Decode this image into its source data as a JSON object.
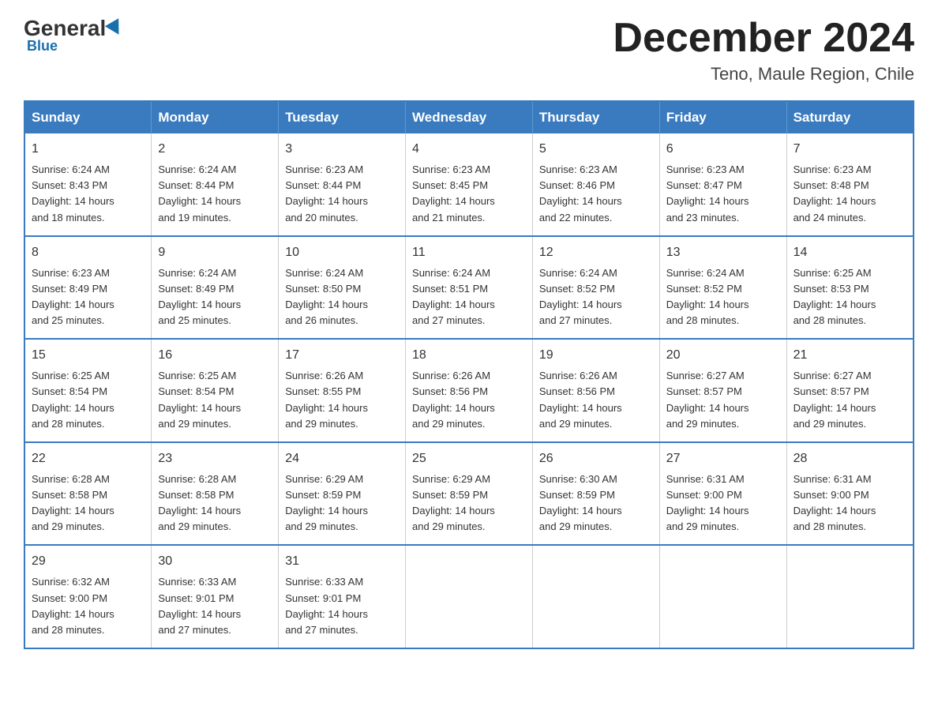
{
  "header": {
    "logo_general": "General",
    "logo_blue": "Blue",
    "month_title": "December 2024",
    "location": "Teno, Maule Region, Chile"
  },
  "days_of_week": [
    "Sunday",
    "Monday",
    "Tuesday",
    "Wednesday",
    "Thursday",
    "Friday",
    "Saturday"
  ],
  "weeks": [
    [
      {
        "day": "1",
        "sunrise": "6:24 AM",
        "sunset": "8:43 PM",
        "daylight": "14 hours and 18 minutes."
      },
      {
        "day": "2",
        "sunrise": "6:24 AM",
        "sunset": "8:44 PM",
        "daylight": "14 hours and 19 minutes."
      },
      {
        "day": "3",
        "sunrise": "6:23 AM",
        "sunset": "8:44 PM",
        "daylight": "14 hours and 20 minutes."
      },
      {
        "day": "4",
        "sunrise": "6:23 AM",
        "sunset": "8:45 PM",
        "daylight": "14 hours and 21 minutes."
      },
      {
        "day": "5",
        "sunrise": "6:23 AM",
        "sunset": "8:46 PM",
        "daylight": "14 hours and 22 minutes."
      },
      {
        "day": "6",
        "sunrise": "6:23 AM",
        "sunset": "8:47 PM",
        "daylight": "14 hours and 23 minutes."
      },
      {
        "day": "7",
        "sunrise": "6:23 AM",
        "sunset": "8:48 PM",
        "daylight": "14 hours and 24 minutes."
      }
    ],
    [
      {
        "day": "8",
        "sunrise": "6:23 AM",
        "sunset": "8:49 PM",
        "daylight": "14 hours and 25 minutes."
      },
      {
        "day": "9",
        "sunrise": "6:24 AM",
        "sunset": "8:49 PM",
        "daylight": "14 hours and 25 minutes."
      },
      {
        "day": "10",
        "sunrise": "6:24 AM",
        "sunset": "8:50 PM",
        "daylight": "14 hours and 26 minutes."
      },
      {
        "day": "11",
        "sunrise": "6:24 AM",
        "sunset": "8:51 PM",
        "daylight": "14 hours and 27 minutes."
      },
      {
        "day": "12",
        "sunrise": "6:24 AM",
        "sunset": "8:52 PM",
        "daylight": "14 hours and 27 minutes."
      },
      {
        "day": "13",
        "sunrise": "6:24 AM",
        "sunset": "8:52 PM",
        "daylight": "14 hours and 28 minutes."
      },
      {
        "day": "14",
        "sunrise": "6:25 AM",
        "sunset": "8:53 PM",
        "daylight": "14 hours and 28 minutes."
      }
    ],
    [
      {
        "day": "15",
        "sunrise": "6:25 AM",
        "sunset": "8:54 PM",
        "daylight": "14 hours and 28 minutes."
      },
      {
        "day": "16",
        "sunrise": "6:25 AM",
        "sunset": "8:54 PM",
        "daylight": "14 hours and 29 minutes."
      },
      {
        "day": "17",
        "sunrise": "6:26 AM",
        "sunset": "8:55 PM",
        "daylight": "14 hours and 29 minutes."
      },
      {
        "day": "18",
        "sunrise": "6:26 AM",
        "sunset": "8:56 PM",
        "daylight": "14 hours and 29 minutes."
      },
      {
        "day": "19",
        "sunrise": "6:26 AM",
        "sunset": "8:56 PM",
        "daylight": "14 hours and 29 minutes."
      },
      {
        "day": "20",
        "sunrise": "6:27 AM",
        "sunset": "8:57 PM",
        "daylight": "14 hours and 29 minutes."
      },
      {
        "day": "21",
        "sunrise": "6:27 AM",
        "sunset": "8:57 PM",
        "daylight": "14 hours and 29 minutes."
      }
    ],
    [
      {
        "day": "22",
        "sunrise": "6:28 AM",
        "sunset": "8:58 PM",
        "daylight": "14 hours and 29 minutes."
      },
      {
        "day": "23",
        "sunrise": "6:28 AM",
        "sunset": "8:58 PM",
        "daylight": "14 hours and 29 minutes."
      },
      {
        "day": "24",
        "sunrise": "6:29 AM",
        "sunset": "8:59 PM",
        "daylight": "14 hours and 29 minutes."
      },
      {
        "day": "25",
        "sunrise": "6:29 AM",
        "sunset": "8:59 PM",
        "daylight": "14 hours and 29 minutes."
      },
      {
        "day": "26",
        "sunrise": "6:30 AM",
        "sunset": "8:59 PM",
        "daylight": "14 hours and 29 minutes."
      },
      {
        "day": "27",
        "sunrise": "6:31 AM",
        "sunset": "9:00 PM",
        "daylight": "14 hours and 29 minutes."
      },
      {
        "day": "28",
        "sunrise": "6:31 AM",
        "sunset": "9:00 PM",
        "daylight": "14 hours and 28 minutes."
      }
    ],
    [
      {
        "day": "29",
        "sunrise": "6:32 AM",
        "sunset": "9:00 PM",
        "daylight": "14 hours and 28 minutes."
      },
      {
        "day": "30",
        "sunrise": "6:33 AM",
        "sunset": "9:01 PM",
        "daylight": "14 hours and 27 minutes."
      },
      {
        "day": "31",
        "sunrise": "6:33 AM",
        "sunset": "9:01 PM",
        "daylight": "14 hours and 27 minutes."
      },
      null,
      null,
      null,
      null
    ]
  ],
  "labels": {
    "sunrise": "Sunrise:",
    "sunset": "Sunset:",
    "daylight": "Daylight:"
  }
}
